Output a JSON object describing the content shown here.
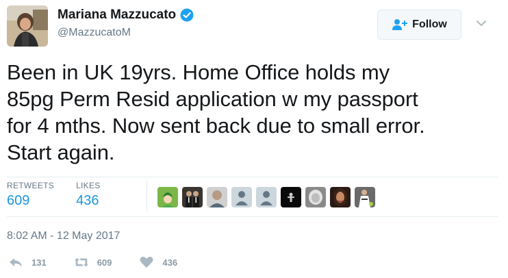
{
  "user": {
    "name": "Mariana Mazzucato",
    "handle": "@MazzucatoM",
    "verified": true,
    "avatar_icon": "profile-photo"
  },
  "follow_button": {
    "label": "Follow",
    "icon": "add-user-icon"
  },
  "tweet": {
    "text_lines": [
      "Been in UK 19yrs. Home Office holds my",
      "85pg Perm Resid application w my passport",
      "for 4 mths. Now sent back due to small error.",
      "Start again."
    ]
  },
  "stats": {
    "retweets_label": "RETWEETS",
    "retweets_value": "609",
    "likes_label": "LIKES",
    "likes_value": "436"
  },
  "likers": [
    {
      "icon": "avatar-green"
    },
    {
      "icon": "avatar-suits"
    },
    {
      "icon": "avatar-man"
    },
    {
      "icon": "avatar-default"
    },
    {
      "icon": "avatar-default"
    },
    {
      "icon": "avatar-dark"
    },
    {
      "icon": "avatar-grey"
    },
    {
      "icon": "avatar-woman"
    },
    {
      "icon": "avatar-player"
    }
  ],
  "timestamp": "8:02 AM - 12 May 2017",
  "actions": {
    "reply_count": "131",
    "retweet_count": "609",
    "like_count": "436"
  },
  "colors": {
    "accent": "#1b95e0",
    "muted": "#657786",
    "verified": "#1da1f2",
    "action_icon": "#aab8c2"
  }
}
